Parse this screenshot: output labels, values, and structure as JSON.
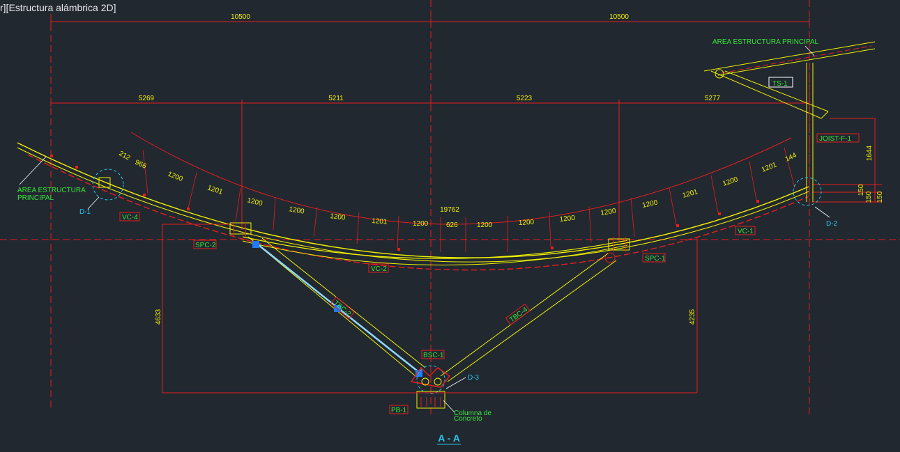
{
  "viewport": {
    "label": "r][Estructura alámbrica 2D]"
  },
  "top_dims": [
    "10500",
    "10500"
  ],
  "second_dims": [
    "5269",
    "5211",
    "5223",
    "5277"
  ],
  "span_dim": "19762",
  "arc_dims": [
    "212",
    "966",
    "1200",
    "1201",
    "1200",
    "1200",
    "1200",
    "1201",
    "1200",
    "626",
    "1200",
    "1200",
    "1200",
    "1200",
    "1200",
    "1201",
    "1200",
    "1201",
    "144"
  ],
  "vertical_dims": [
    "4633",
    "4235",
    "1644",
    "150",
    "150",
    "150"
  ],
  "tags": {
    "vc4": "VC-4",
    "spc2": "SPC-2",
    "vc2": "VC-2",
    "tbc2": "TBC-2",
    "bsc1": "BSC-1",
    "pb1": "PB-1",
    "tbc4": "TBC-4",
    "spc1": "SPC-1",
    "vc1": "VC-1",
    "joist": "JOIST-F-1",
    "ts1": "TS-1"
  },
  "details": {
    "d1": "D-1",
    "d2": "D-2",
    "d3": "D-3"
  },
  "notes": {
    "area_left_1": "AREA ESTRUCTURA",
    "area_left_2": "PRINCIPAL",
    "area_right": "AREA ESTRUCTURA PRINCIPAL",
    "column_1": "Columna de",
    "column_2": "Concreto"
  },
  "section_title": "A - A",
  "colors": {
    "background": "#212830",
    "red": "#e81e1e",
    "yellow": "#f2f200",
    "green": "#39e639",
    "cyan": "#29c7ec",
    "selection": "#1e7cff"
  }
}
